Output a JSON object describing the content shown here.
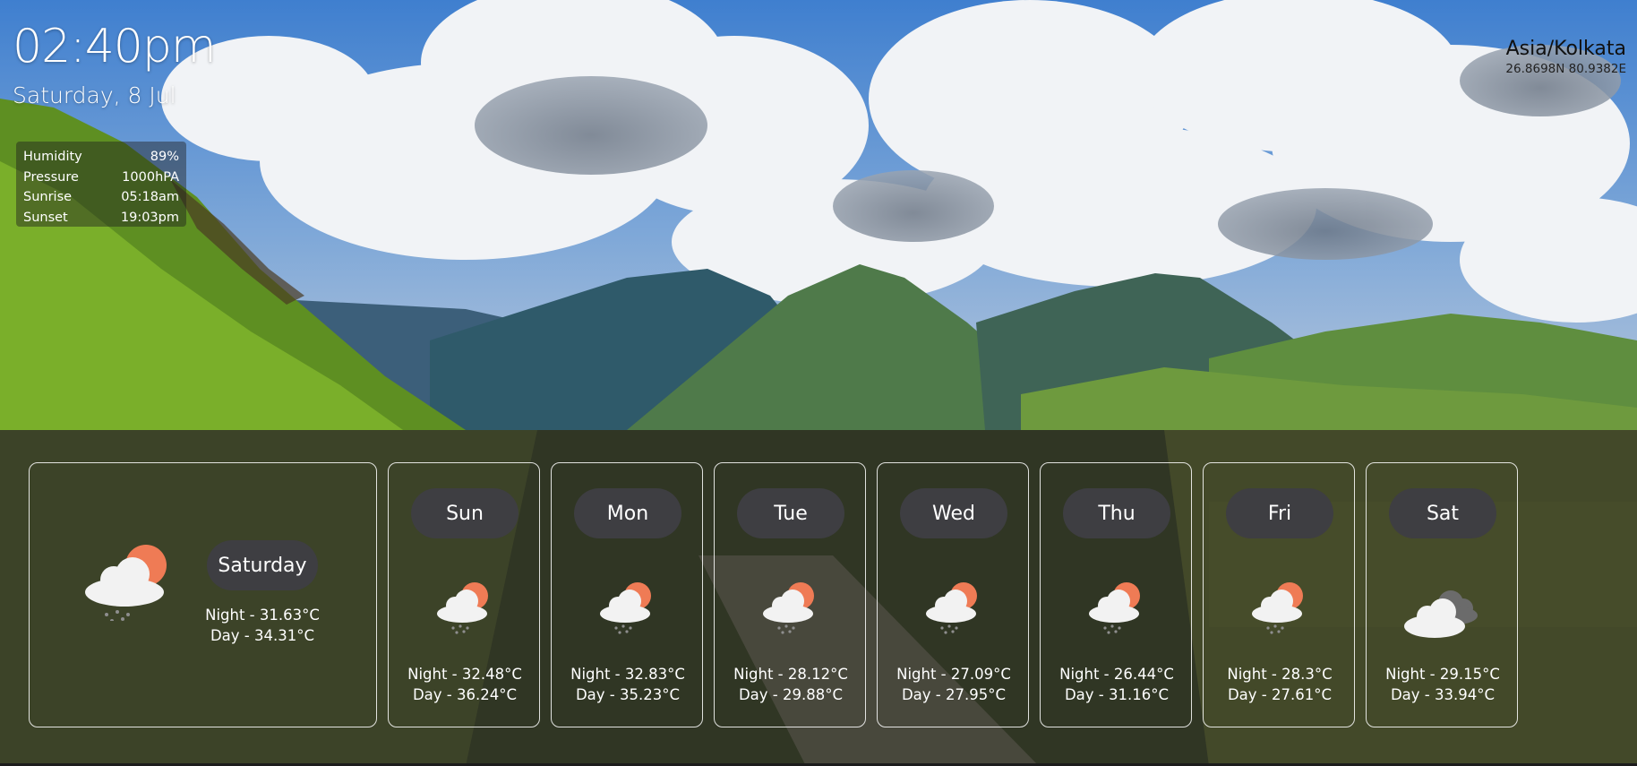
{
  "clock": {
    "time": "02:40pm",
    "date": "Saturday, 8 Jul"
  },
  "details": [
    {
      "label": "Humidity",
      "value": "89%"
    },
    {
      "label": "Pressure",
      "value": "1000hPA"
    },
    {
      "label": "Sunrise",
      "value": "05:18am"
    },
    {
      "label": "Sunset",
      "value": "19:03pm"
    }
  ],
  "location": {
    "timezone": "Asia/Kolkata",
    "coords": "26.8698N 80.9382E"
  },
  "today": {
    "day": "Saturday",
    "night": "Night - 31.63°C",
    "day_temp": "Day - 34.31°C",
    "icon": "partly-cloudy-rain-icon"
  },
  "forecast": [
    {
      "day": "Sun",
      "night": "Night - 32.48°C",
      "day_temp": "Day - 36.24°C",
      "icon": "partly-cloudy-rain-icon"
    },
    {
      "day": "Mon",
      "night": "Night - 32.83°C",
      "day_temp": "Day - 35.23°C",
      "icon": "partly-cloudy-rain-icon"
    },
    {
      "day": "Tue",
      "night": "Night - 28.12°C",
      "day_temp": "Day - 29.88°C",
      "icon": "partly-cloudy-rain-icon"
    },
    {
      "day": "Wed",
      "night": "Night - 27.09°C",
      "day_temp": "Day - 27.95°C",
      "icon": "partly-cloudy-rain-icon"
    },
    {
      "day": "Thu",
      "night": "Night - 26.44°C",
      "day_temp": "Day - 31.16°C",
      "icon": "partly-cloudy-rain-icon"
    },
    {
      "day": "Fri",
      "night": "Night - 28.3°C",
      "day_temp": "Day - 27.61°C",
      "icon": "partly-cloudy-rain-icon"
    },
    {
      "day": "Sat",
      "night": "Night - 29.15°C",
      "day_temp": "Day - 33.94°C",
      "icon": "overcast-clouds-icon"
    }
  ],
  "colors": {
    "sun": "#ef7b55",
    "cloud": "#f2f2f2",
    "dark_cloud": "#6b6b6b",
    "rain": "#8e8e8e",
    "pill": "#3e3e42"
  }
}
